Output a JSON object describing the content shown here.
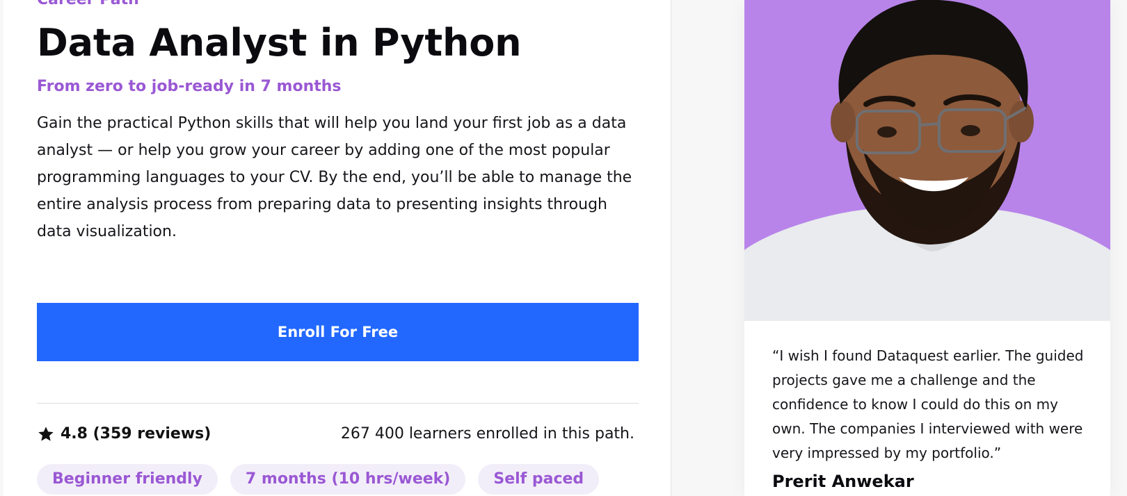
{
  "course": {
    "eyebrow": "Career Path",
    "title": "Data Analyst in Python",
    "subtitle": "From zero to job-ready in 7 months",
    "description": "Gain the practical Python skills that will help you land your first job as a data analyst — or help you grow your career by adding one of the most popular programming languages to your CV. By the end, you’ll be able to manage the entire analysis process from preparing data to presenting insights through data visualization.",
    "enroll_label": "Enroll For Free",
    "rating_text": "4.8 (359 reviews)",
    "learners_text": "267 400 learners enrolled in this path.",
    "tags": [
      "Beginner friendly",
      "7 months (10 hrs/week)",
      "Self paced"
    ]
  },
  "testimonial": {
    "quote": "“I wish I found Dataquest earlier. The guided projects gave me a challenge and the confidence to know I could do this on my own. The companies I interviewed with were very impressed by my portfolio.”",
    "author": "Prerit Anwekar"
  },
  "colors": {
    "accent_purple": "#9a58d4",
    "button_blue": "#2268ff",
    "photo_background": "#b884ea"
  },
  "icons": {
    "rating": "star-icon"
  }
}
